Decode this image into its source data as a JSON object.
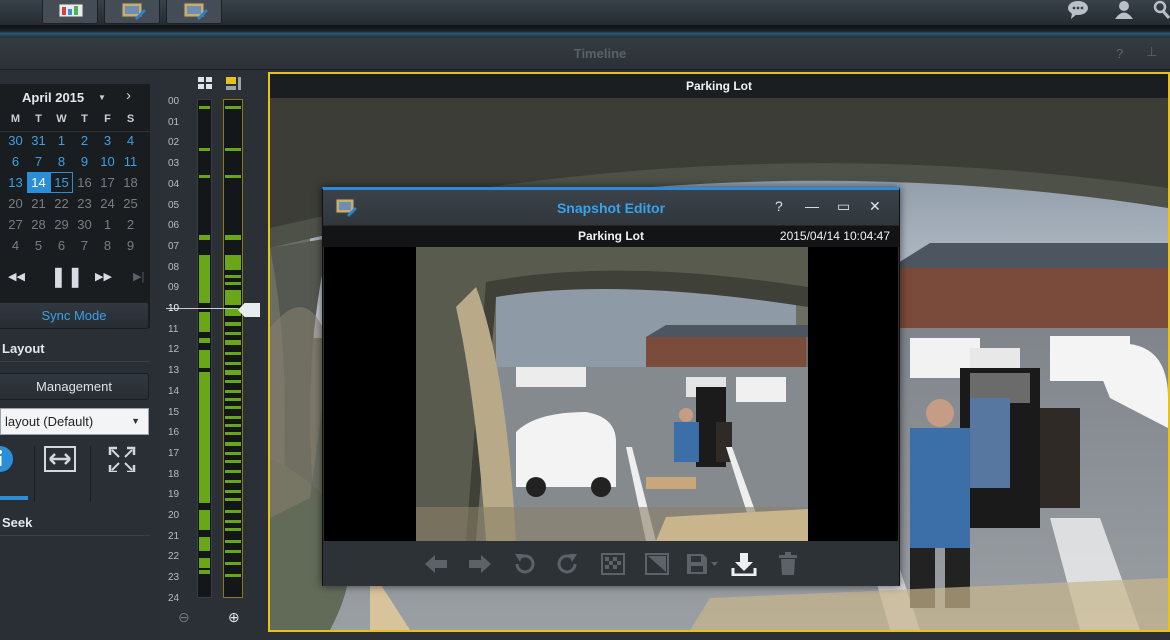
{
  "timeline": {
    "title": "Timeline",
    "help": "?",
    "pin": "⊥"
  },
  "calendar": {
    "month_label": "April 2015",
    "weekdays": [
      "M",
      "T",
      "W",
      "T",
      "F",
      "S"
    ],
    "weeks": [
      [
        {
          "d": "30",
          "t": "cur"
        },
        {
          "d": "31",
          "t": "cur"
        },
        {
          "d": "1",
          "t": "cur"
        },
        {
          "d": "2",
          "t": "cur"
        },
        {
          "d": "3",
          "t": "cur"
        },
        {
          "d": "4",
          "t": "cur"
        }
      ],
      [
        {
          "d": "6",
          "t": "cur"
        },
        {
          "d": "7",
          "t": "cur"
        },
        {
          "d": "8",
          "t": "cur"
        },
        {
          "d": "9",
          "t": "cur"
        },
        {
          "d": "10",
          "t": "cur"
        },
        {
          "d": "11",
          "t": "cur"
        }
      ],
      [
        {
          "d": "13",
          "t": "cur"
        },
        {
          "d": "14",
          "t": "sel"
        },
        {
          "d": "15",
          "t": "today"
        },
        {
          "d": "16",
          "t": "oth"
        },
        {
          "d": "17",
          "t": "oth"
        },
        {
          "d": "18",
          "t": "oth"
        }
      ],
      [
        {
          "d": "20",
          "t": "oth"
        },
        {
          "d": "21",
          "t": "oth"
        },
        {
          "d": "22",
          "t": "oth"
        },
        {
          "d": "23",
          "t": "oth"
        },
        {
          "d": "24",
          "t": "oth"
        },
        {
          "d": "25",
          "t": "oth"
        }
      ],
      [
        {
          "d": "27",
          "t": "oth"
        },
        {
          "d": "28",
          "t": "oth"
        },
        {
          "d": "29",
          "t": "oth"
        },
        {
          "d": "30",
          "t": "oth"
        },
        {
          "d": "1",
          "t": "oth"
        },
        {
          "d": "2",
          "t": "oth"
        }
      ],
      [
        {
          "d": "4",
          "t": "oth"
        },
        {
          "d": "5",
          "t": "oth"
        },
        {
          "d": "6",
          "t": "oth"
        },
        {
          "d": "7",
          "t": "oth"
        },
        {
          "d": "8",
          "t": "oth"
        },
        {
          "d": "9",
          "t": "oth"
        }
      ]
    ]
  },
  "playback": {
    "rewind": "◀◀",
    "pause": "❚❚",
    "forward": "▶▶",
    "step": "▶|"
  },
  "sync_mode_label": "Sync Mode",
  "layout": {
    "heading": "Layout",
    "management_label": "Management",
    "selected_layout": "layout (Default)"
  },
  "seek_heading": "Seek",
  "hours": [
    "00",
    "01",
    "02",
    "03",
    "04",
    "05",
    "06",
    "07",
    "08",
    "09",
    "10",
    "11",
    "12",
    "13",
    "14",
    "15",
    "16",
    "17",
    "18",
    "19",
    "20",
    "21",
    "22",
    "23",
    "24"
  ],
  "current_hour": "10",
  "zoom": {
    "out": "⊖",
    "in": "⊕"
  },
  "camera": {
    "name": "Parking Lot"
  },
  "snapshot_editor": {
    "title": "Snapshot Editor",
    "camera_name": "Parking Lot",
    "timestamp": "2015/04/14 10:04:47",
    "tools": [
      "undo-arrow-icon",
      "redo-arrow-icon",
      "rotate-left-icon",
      "rotate-right-icon",
      "mosaic-icon",
      "crop-icon",
      "save-icon",
      "download-icon",
      "delete-icon"
    ]
  },
  "colors": {
    "accent": "#2e8ad6",
    "recording": "#6aa718",
    "camera_border": "#e8c21c"
  }
}
